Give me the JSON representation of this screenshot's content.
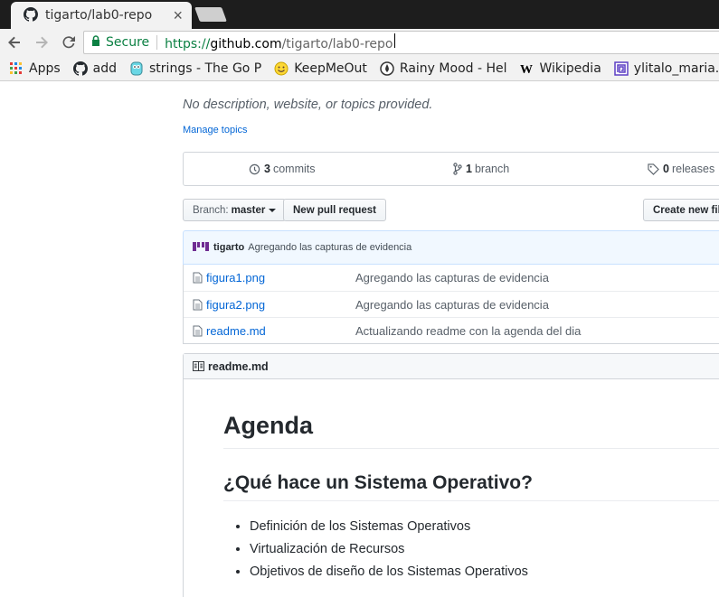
{
  "browser": {
    "tab_title": "tigarto/lab0-repo",
    "close_glyph": "×",
    "secure_label": "Secure",
    "url_scheme": "https://",
    "url_host": "github.com",
    "url_path": "/tigarto/lab0-repo"
  },
  "bookmarks": [
    {
      "label": "Apps",
      "icon": "apps-grid-icon"
    },
    {
      "label": "add",
      "icon": "github-icon"
    },
    {
      "label": "strings - The Go P",
      "icon": "go-gopher-icon"
    },
    {
      "label": "KeepMeOut",
      "icon": "smiley-icon"
    },
    {
      "label": "Rainy Mood - Hel",
      "icon": "raindrop-icon"
    },
    {
      "label": "Wikipedia",
      "icon": "wikipedia-icon"
    },
    {
      "label": "ylitalo_maria.po",
      "icon": "spiral-icon"
    }
  ],
  "repo": {
    "description": "No description, website, or topics provided.",
    "manage_topics": "Manage topics",
    "commits_count": "3",
    "commits_label": "commits",
    "branches_count": "1",
    "branches_label": "branch",
    "releases_count": "0",
    "releases_label": "releases",
    "branch_prefix": "Branch:",
    "branch_name": "master",
    "new_pr_label": "New pull request",
    "create_file_label": "Create new file"
  },
  "latest_commit": {
    "author": "tigarto",
    "message": "Agregando las capturas de evidencia"
  },
  "files": [
    {
      "name": "figura1.png",
      "message": "Agregando las capturas de evidencia"
    },
    {
      "name": "figura2.png",
      "message": "Agregando las capturas de evidencia"
    },
    {
      "name": "readme.md",
      "message": "Actualizando readme con la agenda del dia"
    }
  ],
  "readme": {
    "filename": "readme.md",
    "h1": "Agenda",
    "h2": "¿Qué hace un Sistema Operativo?",
    "items": [
      "Definición de los Sistemas Operativos",
      "Virtualización de Recursos",
      "Objetivos de diseño de los Sistemas Operativos"
    ]
  },
  "colors": {
    "link": "#0366d6",
    "secure_green": "#0b8043",
    "commit_bg": "#f1f8ff",
    "avatar_purple": "#6f2c91"
  }
}
